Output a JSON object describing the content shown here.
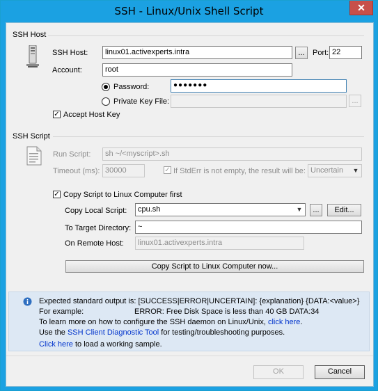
{
  "window": {
    "title": "SSH - Linux/Unix Shell Script",
    "close_glyph": "✕"
  },
  "ssh_host": {
    "group_label": "SSH Host",
    "host_label": "SSH Host:",
    "host_value": "linux01.activexperts.intra",
    "browse_label": "...",
    "port_label": "Port:",
    "port_value": "22",
    "account_label": "Account:",
    "account_value": "root",
    "password_label": "Password:",
    "password_value": "●●●●●●●",
    "password_selected": true,
    "private_key_label": "Private Key File:",
    "private_key_value": "",
    "private_key_browse": "...",
    "accept_host_key_label": "Accept Host Key",
    "accept_host_key_checked": true,
    "icon": "server-icon"
  },
  "ssh_script": {
    "group_label": "SSH Script",
    "icon": "script-file-icon",
    "run_script_label": "Run Script:",
    "run_script_value": "sh ~/<myscript>.sh",
    "timeout_label": "Timeout (ms):",
    "timeout_value": "30000",
    "stderr_label": "If StdErr is not empty, the result will be:",
    "stderr_checked": true,
    "stderr_result": "Uncertain",
    "copy_script_label": "Copy Script to Linux Computer first",
    "copy_script_checked": true,
    "copy_local_label": "Copy Local Script:",
    "copy_local_value": "cpu.sh",
    "copy_local_browse": "...",
    "edit_label": "Edit...",
    "target_dir_label": "To Target Directory:",
    "target_dir_value": "~",
    "remote_host_label": "On Remote Host:",
    "remote_host_value": "linux01.activexperts.intra",
    "copy_now_label": "Copy Script to Linux Computer now..."
  },
  "info": {
    "icon": "info-icon",
    "line1": "Expected standard output is: [SUCCESS|ERROR|UNCERTAIN]: {explanation} {DATA:<value>}",
    "line2_a": "For example:",
    "line2_b": "ERROR: Free Disk Space is less than 40 GB DATA:34",
    "line3_a": "To learn more on how to configure the SSH daemon on Linux/Unix, ",
    "line3_link": "click here",
    "line3_b": ".",
    "line4_a": "Use the ",
    "line4_link": "SSH Client Diagnostic Tool",
    "line4_b": " for testing/troubleshooting purposes.",
    "line5_link": "Click here",
    "line5_b": " to load a working sample."
  },
  "footer": {
    "ok_label": "OK",
    "cancel_label": "Cancel"
  },
  "colors": {
    "title_bar": "#1ba1e2",
    "close_button": "#c7504a",
    "link": "#0033cc",
    "info_panel": "#dde8f4"
  }
}
